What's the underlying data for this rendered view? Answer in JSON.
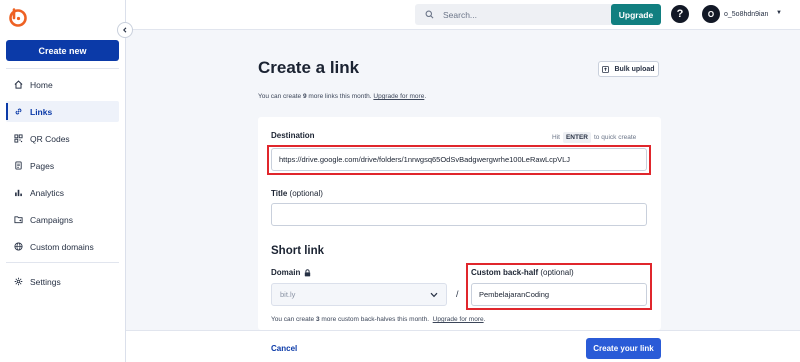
{
  "brand": {
    "accent": "#0b3aa8",
    "logo_color": "#ee6123",
    "upgrade_color": "#117f80",
    "cta_color": "#2a5bd7",
    "highlight_color": "#e0262c"
  },
  "sidebar": {
    "create_new_label": "Create new",
    "items": [
      {
        "label": "Home",
        "icon": "home-icon",
        "active": false
      },
      {
        "label": "Links",
        "icon": "link-icon",
        "active": true
      },
      {
        "label": "QR Codes",
        "icon": "qr-code-icon",
        "active": false
      },
      {
        "label": "Pages",
        "icon": "pages-icon",
        "active": false
      },
      {
        "label": "Analytics",
        "icon": "analytics-icon",
        "active": false
      },
      {
        "label": "Campaigns",
        "icon": "campaigns-icon",
        "active": false
      },
      {
        "label": "Custom domains",
        "icon": "globe-icon",
        "active": false
      },
      {
        "label": "Settings",
        "icon": "gear-icon",
        "active": false
      }
    ]
  },
  "topbar": {
    "search_placeholder": "Search...",
    "upgrade_label": "Upgrade",
    "help_glyph": "?",
    "avatar_initial": "O",
    "username": "o_5o8hdn9ian"
  },
  "page": {
    "title": "Create a link",
    "bulk_upload_label": "Bulk upload",
    "limit_prefix": "You can create ",
    "limit_count": "9",
    "limit_suffix": " more links this month. ",
    "limit_upgrade_link": "Upgrade for more",
    "limit_end": "."
  },
  "form": {
    "destination_label": "Destination",
    "hint_prefix": "Hit",
    "hint_key": "ENTER",
    "hint_suffix": "to quick create",
    "destination_value": "https://drive.google.com/drive/folders/1nrwgsq65OdSvBadgwergwrhe100LeRawLcpVLJ",
    "title_label": "Title",
    "title_optional": " (optional)",
    "title_value": "",
    "short_link_heading": "Short link",
    "domain_label": "Domain",
    "domain_value": "bit.ly",
    "separator": "/",
    "backhalf_label": "Custom back-half",
    "backhalf_optional": " (optional)",
    "backhalf_value": "PembelajaranCoding",
    "backhalf_note_prefix": "You can create ",
    "backhalf_note_count": "3",
    "backhalf_note_suffix": " more custom back-halves this month.",
    "backhalf_upgrade_link": "Upgrade for more",
    "backhalf_note_end": "."
  },
  "footer": {
    "cancel_label": "Cancel",
    "create_label": "Create your link"
  }
}
